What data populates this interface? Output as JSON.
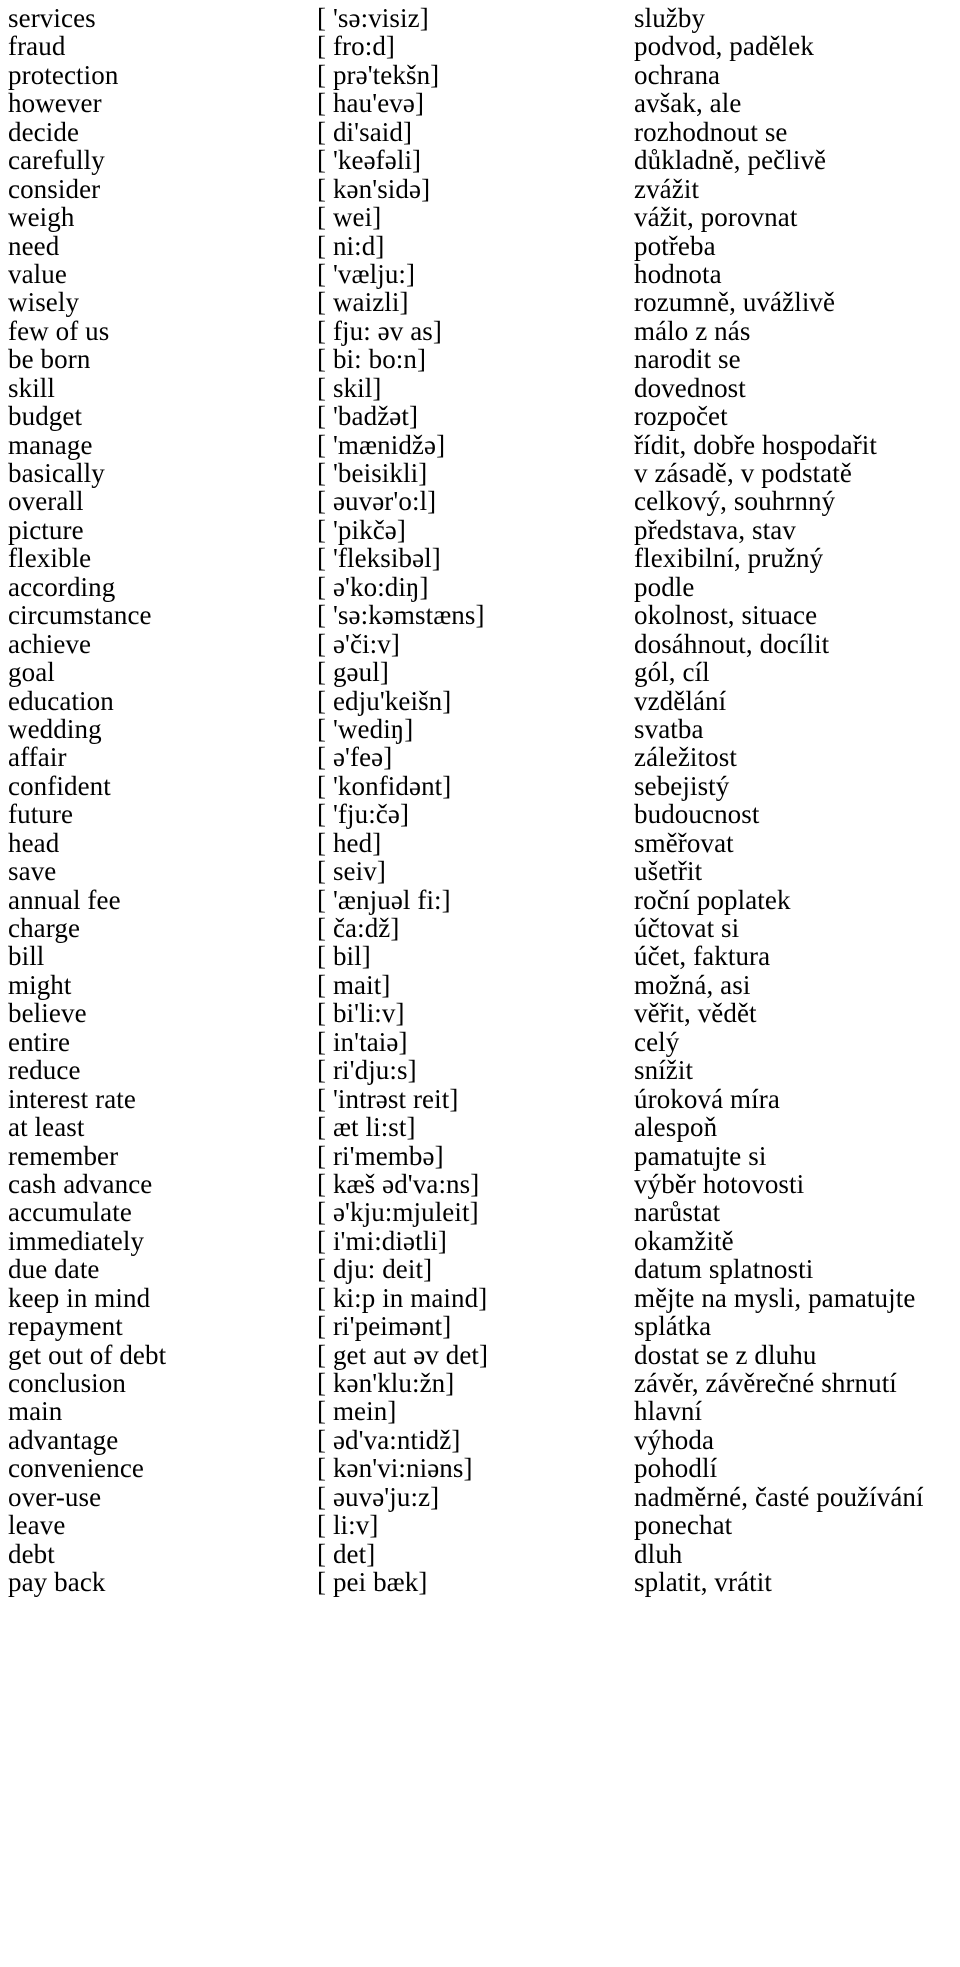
{
  "document": {
    "kind": "vocabulary-list",
    "columns": [
      "word",
      "phonetic",
      "translation"
    ],
    "source_language": "English",
    "target_language": "Czech"
  },
  "rows": [
    {
      "word": "services",
      "phonetic": "[ 'sə:visiz]",
      "translation": "služby"
    },
    {
      "word": "fraud",
      "phonetic": "[ fro:d]",
      "translation": "podvod, padělek"
    },
    {
      "word": "protection",
      "phonetic": "[ prə'tekšn]",
      "translation": "ochrana"
    },
    {
      "word": "however",
      "phonetic": "[ hau'evə]",
      "translation": "avšak, ale"
    },
    {
      "word": "decide",
      "phonetic": "[ di'said]",
      "translation": "rozhodnout se"
    },
    {
      "word": "carefully",
      "phonetic": "[ 'keəfəli]",
      "translation": "důkladně, pečlivě"
    },
    {
      "word": "consider",
      "phonetic": "[ kən'sidə]",
      "translation": "zvážit"
    },
    {
      "word": "weigh",
      "phonetic": "[ wei]",
      "translation": "vážit, porovnat"
    },
    {
      "word": "need",
      "phonetic": "[ ni:d]",
      "translation": "potřeba"
    },
    {
      "word": "value",
      "phonetic": "[ 'vælju:]",
      "translation": "hodnota"
    },
    {
      "word": "wisely",
      "phonetic": "[ waizli]",
      "translation": "rozumně, uvážlivě"
    },
    {
      "word": "few of us",
      "phonetic": "[ fju: əv as]",
      "translation": "málo z nás"
    },
    {
      "word": "be born",
      "phonetic": "[ bi: bo:n]",
      "translation": "narodit se"
    },
    {
      "word": "skill",
      "phonetic": "[ skil]",
      "translation": "dovednost"
    },
    {
      "word": "budget",
      "phonetic": "[ 'badžət]",
      "translation": "rozpočet"
    },
    {
      "word": "manage",
      "phonetic": "[ 'mænidžə]",
      "translation": "řídit, dobře hospodařit"
    },
    {
      "word": "basically",
      "phonetic": "[ 'beisikli]",
      "translation": "v zásadě, v podstatě"
    },
    {
      "word": "overall",
      "phonetic": "[ əuvər'o:l]",
      "translation": "celkový, souhrnný"
    },
    {
      "word": "picture",
      "phonetic": "[ 'pikčə]",
      "translation": "představa, stav"
    },
    {
      "word": "flexible",
      "phonetic": "[ 'fleksibəl]",
      "translation": "flexibilní, pružný"
    },
    {
      "word": "according",
      "phonetic": "[ ə'ko:diŋ]",
      "translation": "podle"
    },
    {
      "word": "circumstance",
      "phonetic": "[ 'sə:kəmstæns]",
      "translation": "okolnost, situace"
    },
    {
      "word": "achieve",
      "phonetic": "[ ə'či:v]",
      "translation": "dosáhnout, docílit"
    },
    {
      "word": "goal",
      "phonetic": "[ gəul]",
      "translation": "gól, cíl"
    },
    {
      "word": "education",
      "phonetic": "[ edju'keišn]",
      "translation": "vzdělání"
    },
    {
      "word": "wedding",
      "phonetic": "[ 'wediŋ]",
      "translation": "svatba"
    },
    {
      "word": "affair",
      "phonetic": "[ ə'feə]",
      "translation": "záležitost"
    },
    {
      "word": "confident",
      "phonetic": "[ 'konfidənt]",
      "translation": "sebejistý"
    },
    {
      "word": "future",
      "phonetic": "[ 'fju:čə]",
      "translation": "budoucnost"
    },
    {
      "word": "head",
      "phonetic": "[ hed]",
      "translation": "směřovat"
    },
    {
      "word": "save",
      "phonetic": "[ seiv]",
      "translation": "ušetřit"
    },
    {
      "word": "annual fee",
      "phonetic": "[ 'ænjuəl fi:]",
      "translation": "roční poplatek"
    },
    {
      "word": "charge",
      "phonetic": "[ ča:dž]",
      "translation": "účtovat si"
    },
    {
      "word": "bill",
      "phonetic": "[ bil]",
      "translation": "účet, faktura"
    },
    {
      "word": "might",
      "phonetic": "[ mait]",
      "translation": "možná, asi"
    },
    {
      "word": "believe",
      "phonetic": "[ bi'li:v]",
      "translation": "věřit, vědět"
    },
    {
      "word": "entire",
      "phonetic": "[ in'taiə]",
      "translation": "celý"
    },
    {
      "word": "reduce",
      "phonetic": "[ ri'dju:s]",
      "translation": "snížit"
    },
    {
      "word": "interest rate",
      "phonetic": "[ 'intrəst reit]",
      "translation": "úroková míra"
    },
    {
      "word": "at least",
      "phonetic": "[ æt li:st]",
      "translation": "alespoň"
    },
    {
      "word": "remember",
      "phonetic": "[ ri'membə]",
      "translation": "pamatujte si"
    },
    {
      "word": "cash advance",
      "phonetic": "[ kæš əd'va:ns]",
      "translation": "výběr hotovosti"
    },
    {
      "word": "accumulate",
      "phonetic": "[ ə'kju:mjuleit]",
      "translation": "narůstat"
    },
    {
      "word": "immediately",
      "phonetic": "[ i'mi:diətli]",
      "translation": "okamžitě"
    },
    {
      "word": "due date",
      "phonetic": "[ dju: deit]",
      "translation": "datum splatnosti"
    },
    {
      "word": "keep in mind",
      "phonetic": "[ ki:p in maind]",
      "translation": "mějte na mysli, pamatujte"
    },
    {
      "word": "repayment",
      "phonetic": "[ ri'peimənt]",
      "translation": "splátka"
    },
    {
      "word": "get out of debt",
      "phonetic": "[ get aut əv det]",
      "translation": "dostat se z dluhu"
    },
    {
      "word": "conclusion",
      "phonetic": "[ kən'klu:žn]",
      "translation": "závěr, závěrečné shrnutí"
    },
    {
      "word": "main",
      "phonetic": "[ mein]",
      "translation": "hlavní"
    },
    {
      "word": "advantage",
      "phonetic": "[ əd'va:ntidž]",
      "translation": "výhoda"
    },
    {
      "word": "convenience",
      "phonetic": "[ kən'vi:niəns]",
      "translation": "pohodlí"
    },
    {
      "word": "over-use",
      "phonetic": "[ əuvə'ju:z]",
      "translation": "nadměrné, časté používání"
    },
    {
      "word": "leave",
      "phonetic": "[ li:v]",
      "translation": "ponechat"
    },
    {
      "word": "debt",
      "phonetic": "[ det]",
      "translation": "dluh"
    },
    {
      "word": "pay back",
      "phonetic": "[ pei bæk]",
      "translation": "splatit, vrátit"
    }
  ]
}
